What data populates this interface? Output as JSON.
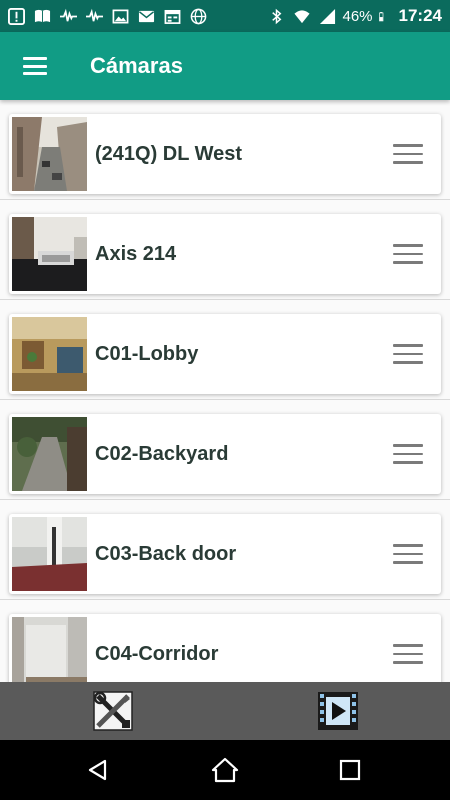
{
  "status_bar": {
    "battery_percent": "46%",
    "time": "17:24",
    "left_icons": [
      "alert-icon",
      "book-icon",
      "pulse-icon",
      "pulse-icon",
      "image-icon",
      "mail-icon",
      "calendar-icon",
      "globe-icon"
    ],
    "right_icons": [
      "bluetooth-icon",
      "wifi-icon",
      "signal-icon",
      "battery-icon"
    ]
  },
  "app_bar": {
    "title": "Cámaras",
    "menu_icon": "hamburger-menu-icon"
  },
  "cameras": [
    {
      "name": "(241Q) DL West"
    },
    {
      "name": "Axis 214"
    },
    {
      "name": "C01-Lobby"
    },
    {
      "name": "C02-Backyard"
    },
    {
      "name": "C03-Back door"
    },
    {
      "name": "C04-Corridor"
    }
  ],
  "toolbar": {
    "tools_icon": "tools-icon",
    "play_icon": "video-play-icon"
  },
  "nav_bar": {
    "back_icon": "back-icon",
    "home_icon": "home-icon",
    "recents_icon": "recents-icon"
  },
  "colors": {
    "status_bar": "#0b6b5d",
    "app_bar": "#119c85",
    "toolbar": "#5a5a5a",
    "nav_bar": "#000000",
    "camera_name": "#2a3b36"
  }
}
